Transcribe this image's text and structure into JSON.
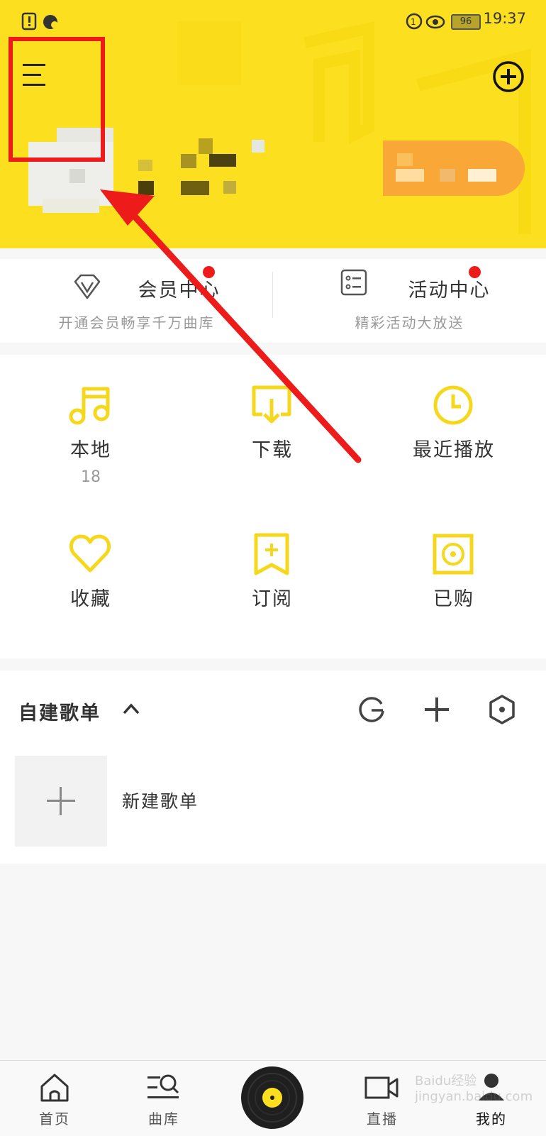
{
  "status_bar": {
    "battery": "96",
    "time": "19:37"
  },
  "vip": [
    {
      "title": "会员中心",
      "subtitle": "开通会员畅享千万曲库"
    },
    {
      "title": "活动中心",
      "subtitle": "精彩活动大放送"
    }
  ],
  "grid": [
    {
      "label": "本地",
      "count": "18",
      "icon": "music-note-icon"
    },
    {
      "label": "下载",
      "icon": "download-icon"
    },
    {
      "label": "最近播放",
      "icon": "clock-icon"
    },
    {
      "label": "收藏",
      "icon": "heart-icon"
    },
    {
      "label": "订阅",
      "icon": "bookmark-add-icon"
    },
    {
      "label": "已购",
      "icon": "disc-icon"
    }
  ],
  "playlists": {
    "title": "自建歌单",
    "new_label": "新建歌单"
  },
  "tabbar": [
    {
      "label": "首页",
      "icon": "home-icon"
    },
    {
      "label": "曲库",
      "icon": "library-search-icon"
    },
    {
      "label": "",
      "icon": "vinyl-player-icon"
    },
    {
      "label": "直播",
      "icon": "video-icon"
    },
    {
      "label": "我的",
      "icon": "person-icon"
    }
  ],
  "colors": {
    "accent": "#fcdf1e",
    "icon_yellow": "#f5d81c",
    "highlight": "#ee1b1b",
    "text": "#333333",
    "muted": "#999999"
  },
  "watermark": "Baidu经验 jingyan.baidu.com"
}
